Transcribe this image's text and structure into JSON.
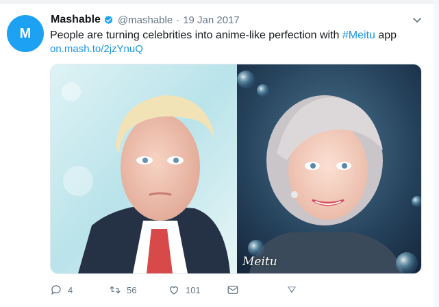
{
  "tweet": {
    "avatar_letter": "M",
    "author_name": "Mashable",
    "handle": "@mashable",
    "separator": "·",
    "date": "19 Jan 2017",
    "text_before": "People are turning celebrities into anime-like perfection with ",
    "hashtag": "#Meitu",
    "text_after": " app",
    "link": "on.mash.to/2jzYnuQ",
    "media": {
      "watermark": "Meitu"
    },
    "actions": {
      "replies": "4",
      "retweets": "56",
      "likes": "101"
    },
    "colors": {
      "brand": "#1da1f2",
      "link": "#1b95e0",
      "muted": "#657786",
      "text": "#14171a"
    },
    "icons": [
      "verified-icon",
      "caret-down-icon",
      "reply-icon",
      "retweet-icon",
      "like-icon",
      "message-icon",
      "bookmark-icon"
    ]
  }
}
